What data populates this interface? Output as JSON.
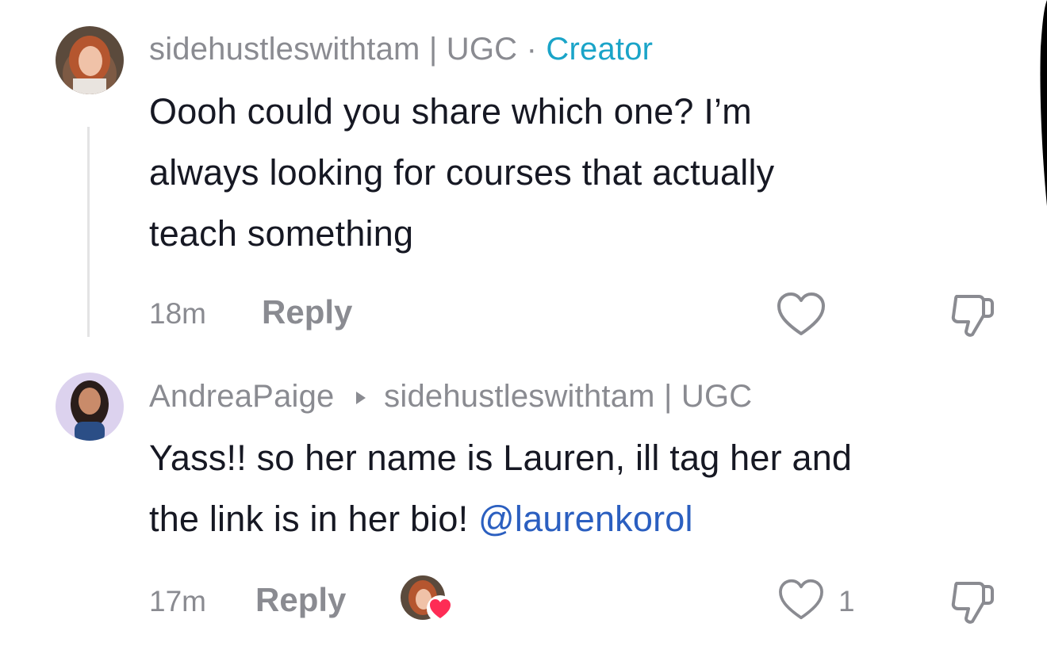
{
  "comments": [
    {
      "username": "sidehustleswithtam | UGC",
      "separator": "·",
      "creator_badge": "Creator",
      "text_lines": [
        "Oooh could you share which one? I’m",
        "always looking for courses that actually",
        "teach something"
      ],
      "time": "18m",
      "reply_label": "Reply"
    },
    {
      "username": "AndreaPaige",
      "reply_to": "sidehustleswithtam | UGC",
      "text_line1": "Yass!! so her name is Lauren, ill tag her and",
      "text_line2_prefix": "the link is in her bio! ",
      "mention": "@laurenkorol",
      "time": "17m",
      "reply_label": "Reply",
      "like_count": "1"
    }
  ],
  "icons": [
    "heart-outline-icon",
    "thumbs-down-icon",
    "reply-arrow-icon",
    "liked-by-creator-heart-icon"
  ],
  "colors": {
    "creator": "#1aa4c8",
    "mention": "#2b5fc0",
    "meta": "#8a8b91",
    "liked_heart": "#fe2c55"
  }
}
